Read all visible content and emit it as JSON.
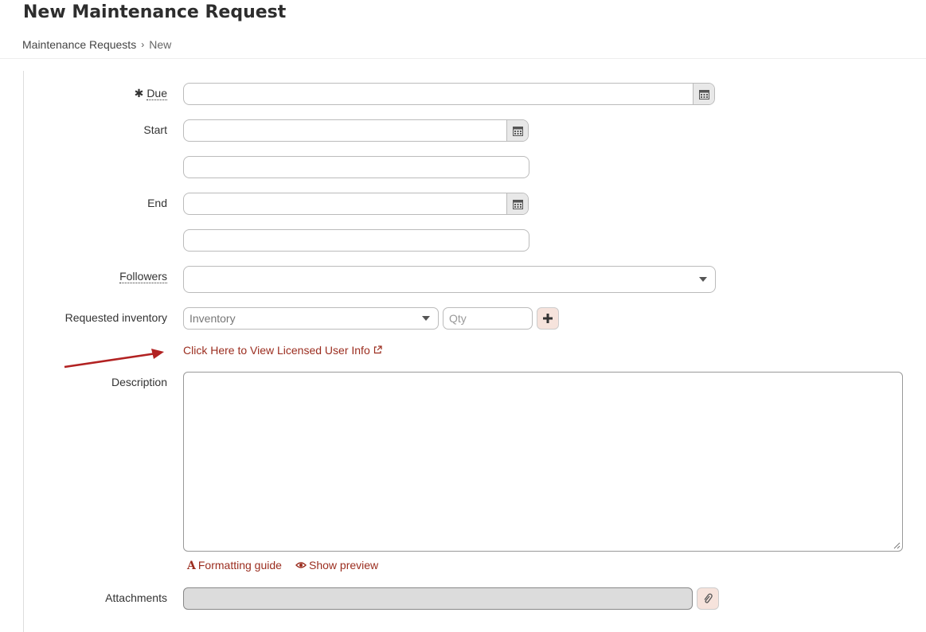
{
  "page": {
    "title": "New Maintenance Request"
  },
  "breadcrumb": {
    "parent": "Maintenance Requests",
    "separator": "›",
    "current": "New"
  },
  "form": {
    "due": {
      "label": "Due",
      "required_mark": "✱",
      "value": ""
    },
    "start": {
      "label": "Start",
      "date_value": "",
      "time_value": ""
    },
    "end": {
      "label": "End",
      "date_value": "",
      "time_value": ""
    },
    "followers": {
      "label": "Followers",
      "value": ""
    },
    "requested_inventory": {
      "label": "Requested inventory",
      "inventory_placeholder": "Inventory",
      "qty_placeholder": "Qty",
      "add_icon": "plus-icon"
    },
    "licensed_link": {
      "text": "Click Here to View Licensed User Info",
      "icon": "external-link-icon"
    },
    "description": {
      "label": "Description",
      "value": ""
    },
    "editor_links": {
      "formatting_guide": "Formatting guide",
      "show_preview": "Show preview"
    },
    "attachments": {
      "label": "Attachments",
      "icon": "paperclip-icon"
    }
  },
  "colors": {
    "link": "#9b2d1f",
    "button_bg": "#f6e3dc",
    "arrow": "#b22222",
    "addon_bg": "#e8e8e8"
  }
}
